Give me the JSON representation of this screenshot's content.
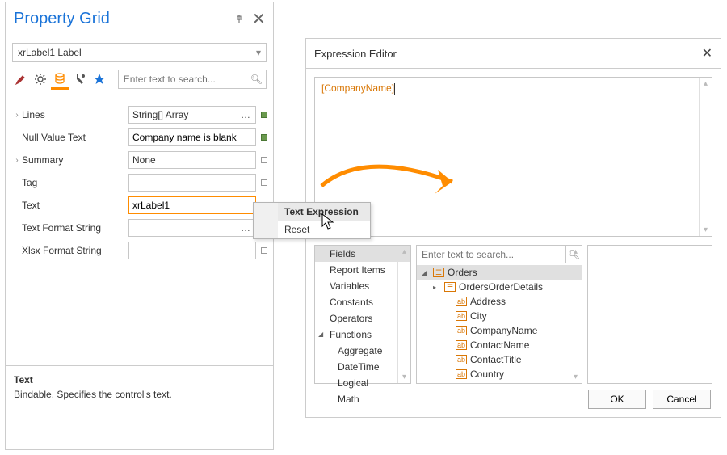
{
  "propertyGrid": {
    "title": "Property Grid",
    "object": "xrLabel1   Label",
    "searchPlaceholder": "Enter text to search...",
    "tabs": [
      "pencil",
      "gear",
      "db",
      "wrench",
      "star"
    ],
    "activeTab": 2,
    "props": {
      "lines": {
        "label": "Lines",
        "value": "String[] Array",
        "hasEllipsis": true,
        "markerFilled": true,
        "expandable": true
      },
      "nullValueText": {
        "label": "Null Value Text",
        "value": "Company name is blank",
        "markerFilled": true
      },
      "summary": {
        "label": "Summary",
        "value": "None",
        "expandable": true
      },
      "tag": {
        "label": "Tag",
        "value": ""
      },
      "text": {
        "label": "Text",
        "value": "xrLabel1",
        "focused": true
      },
      "textFormatString": {
        "label": "Text Format String",
        "value": "",
        "hasEllipsis": true
      },
      "xlsxFormatString": {
        "label": "Xlsx Format String",
        "value": ""
      }
    },
    "description": {
      "title": "Text",
      "body": "Bindable. Specifies the control's text."
    }
  },
  "contextMenu": {
    "textExpression": "Text Expression",
    "reset": "Reset"
  },
  "expressionEditor": {
    "title": "Expression Editor",
    "expression": "[CompanyName]",
    "searchPlaceholder": "Enter text to search...",
    "categories": {
      "fields": "Fields",
      "reportItems": "Report Items",
      "variables": "Variables",
      "constants": "Constants",
      "operators": "Operators",
      "functions": "Functions",
      "aggregate": "Aggregate",
      "dateTime": "DateTime",
      "logical": "Logical",
      "math": "Math"
    },
    "fields": {
      "root": "Orders",
      "items": [
        "OrdersOrderDetails",
        "Address",
        "City",
        "CompanyName",
        "ContactName",
        "ContactTitle",
        "Country"
      ]
    },
    "buttons": {
      "ok": "OK",
      "cancel": "Cancel"
    }
  }
}
